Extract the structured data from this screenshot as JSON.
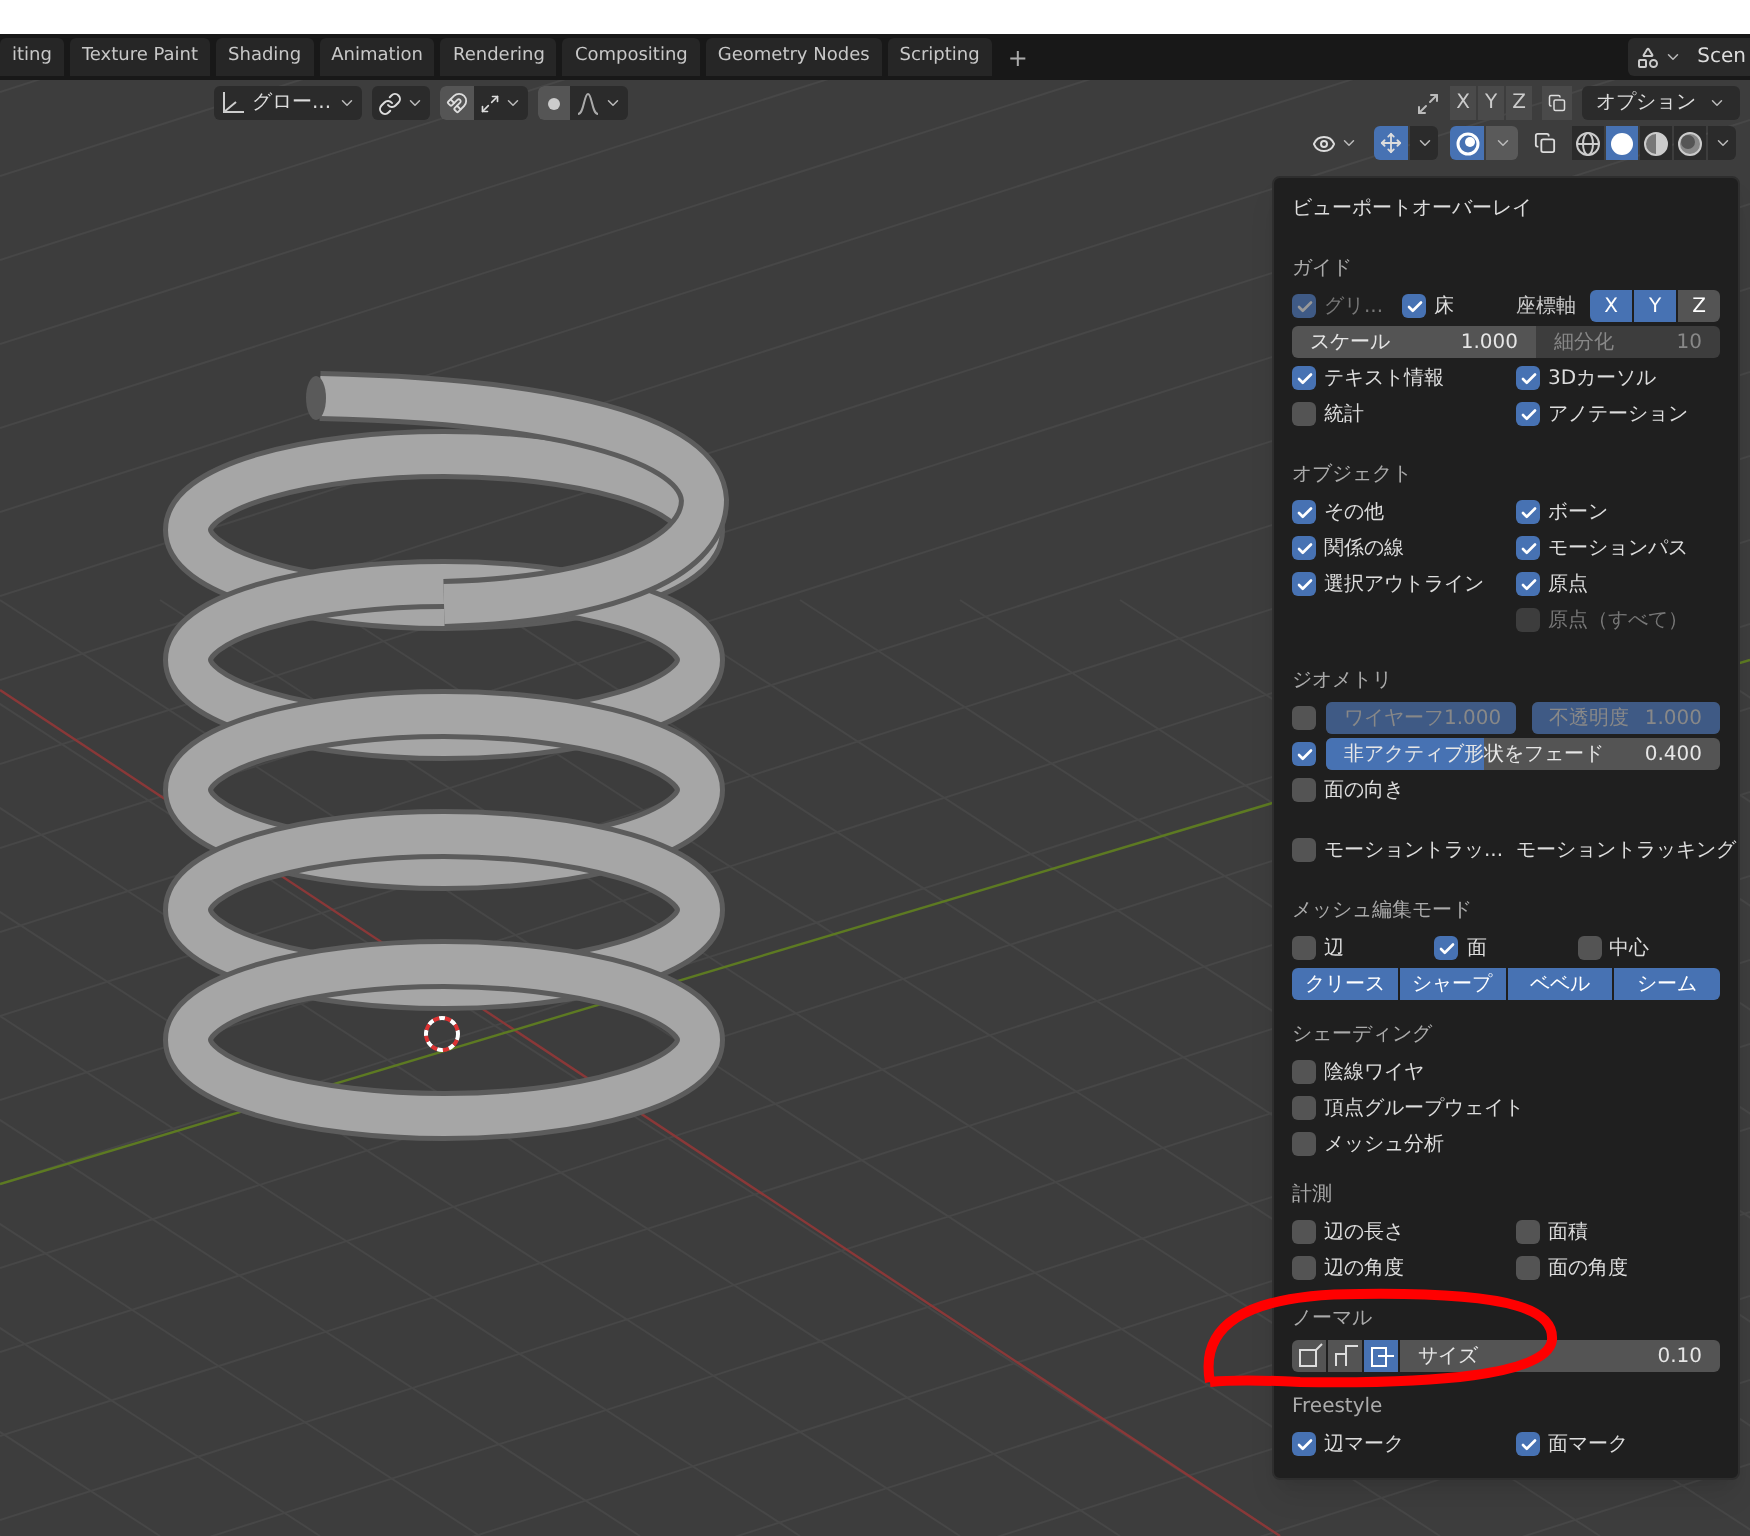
{
  "workspace_tabs": [
    {
      "label": "iting"
    },
    {
      "label": "Texture Paint"
    },
    {
      "label": "Shading"
    },
    {
      "label": "Animation"
    },
    {
      "label": "Rendering"
    },
    {
      "label": "Compositing"
    },
    {
      "label": "Geometry Nodes"
    },
    {
      "label": "Scripting"
    }
  ],
  "add_tab": "+",
  "scene": "Scen",
  "header": {
    "transform_orientation": "グロー...",
    "axis_buttons": [
      {
        "label": "X",
        "selected": false
      },
      {
        "label": "Y",
        "selected": false
      },
      {
        "label": "Z",
        "selected": false
      }
    ],
    "options": "オプション",
    "gizmo_on": true,
    "overlays_on": true,
    "shading_modes": [
      {
        "kind": "wireframe",
        "selected": false
      },
      {
        "kind": "solid",
        "selected": true
      },
      {
        "kind": "material",
        "selected": false
      },
      {
        "kind": "rendered",
        "selected": false
      }
    ]
  },
  "overlay_panel": {
    "title": "ビューポートオーバーレイ",
    "sections": [
      {
        "title": "ガイド",
        "rows": [
          {
            "kind": "guide",
            "grid": {
              "label": "グリ...",
              "checked": true,
              "disabled": true
            },
            "floor": {
              "label": "床",
              "checked": true,
              "disabled": false
            },
            "axes_label": "座標軸",
            "axes": [
              {
                "label": "X",
                "selected": true
              },
              {
                "label": "Y",
                "selected": true
              },
              {
                "label": "Z",
                "selected": false
              }
            ]
          },
          {
            "kind": "fields",
            "fields": [
              {
                "label": "スケール",
                "value": "1.000",
                "disabled": false
              },
              {
                "label": "細分化",
                "value": "10",
                "disabled": true
              }
            ]
          },
          {
            "kind": "columns",
            "left": [
              {
                "label": "テキスト情報",
                "checked": true,
                "disabled": false
              },
              {
                "label": "統計",
                "checked": false,
                "disabled": false
              }
            ],
            "right": [
              {
                "label": "3Dカーソル",
                "checked": true,
                "disabled": false
              },
              {
                "label": "アノテーション",
                "checked": true,
                "disabled": false
              }
            ]
          }
        ]
      },
      {
        "title": "オブジェクト",
        "rows": [
          {
            "kind": "columns",
            "left": [
              {
                "label": "その他",
                "checked": true,
                "disabled": false
              },
              {
                "label": "関係の線",
                "checked": true,
                "disabled": false
              },
              {
                "label": "選択アウトライン",
                "checked": true,
                "disabled": false
              }
            ],
            "right": [
              {
                "label": "ボーン",
                "checked": true,
                "disabled": false
              },
              {
                "label": "モーションパス",
                "checked": true,
                "disabled": false
              },
              {
                "label": "原点",
                "checked": true,
                "disabled": false
              },
              {
                "label": "原点（すべて）",
                "checked": false,
                "disabled": true
              }
            ]
          }
        ]
      },
      {
        "title": "ジオメトリ",
        "rows": [
          {
            "kind": "check_fields",
            "checked": false,
            "fields": [
              {
                "label": "ワイヤーフ",
                "value": "1.000",
                "disabled": true,
                "level": 1
              },
              {
                "label": "不透明度",
                "value": "1.000",
                "disabled": true,
                "level": 1
              }
            ]
          },
          {
            "kind": "check_fields",
            "checked": true,
            "fields": [
              {
                "label": "非アクティブ形状をフェード",
                "value": "0.400",
                "disabled": false,
                "level": 0.4
              }
            ]
          },
          {
            "kind": "columns",
            "left": [
              {
                "label": "面の向き",
                "checked": false,
                "disabled": false
              }
            ]
          }
        ]
      },
      {
        "rows": [
          {
            "kind": "check_label",
            "check": {
              "label": "モーショントラッ...",
              "checked": false,
              "disabled": false
            },
            "text": "モーショントラッキング"
          }
        ]
      },
      {
        "title": "メッシュ編集モード",
        "rows": [
          {
            "kind": "check_row",
            "checks": [
              {
                "label": "辺",
                "checked": false,
                "disabled": false
              },
              {
                "label": "面",
                "checked": true,
                "disabled": false
              },
              {
                "label": "中心",
                "checked": false,
                "disabled": false
              }
            ]
          },
          {
            "kind": "buttons",
            "buttons": [
              {
                "label": "クリース",
                "selected": true
              },
              {
                "label": "シャープ",
                "selected": true
              },
              {
                "label": "ベベル",
                "selected": true
              },
              {
                "label": "シーム",
                "selected": true
              }
            ]
          }
        ]
      },
      {
        "title": "シェーディング",
        "rows": [
          {
            "kind": "columns",
            "left": [
              {
                "label": "陰線ワイヤ",
                "checked": false,
                "disabled": false
              },
              {
                "label": "頂点グループウェイト",
                "checked": false,
                "disabled": false
              },
              {
                "label": "メッシュ分析",
                "checked": false,
                "disabled": false
              }
            ]
          }
        ]
      },
      {
        "title": "計測",
        "rows": [
          {
            "kind": "columns",
            "left": [
              {
                "label": "辺の長さ",
                "checked": false,
                "disabled": false
              },
              {
                "label": "辺の角度",
                "checked": false,
                "disabled": false
              }
            ],
            "right": [
              {
                "label": "面積",
                "checked": false,
                "disabled": false
              },
              {
                "label": "面の角度",
                "checked": false,
                "disabled": false
              }
            ]
          }
        ]
      },
      {
        "title": "ノーマル",
        "rows": [
          {
            "kind": "normals",
            "toggles": [
              {
                "kind": "vertex",
                "selected": false
              },
              {
                "kind": "split",
                "selected": false
              },
              {
                "kind": "face",
                "selected": true
              }
            ],
            "field": {
              "label": "サイズ",
              "value": "0.10"
            }
          }
        ]
      },
      {
        "title": "Freestyle",
        "rows": [
          {
            "kind": "columns",
            "left": [
              {
                "label": "辺マーク",
                "checked": true,
                "disabled": false
              }
            ],
            "right": [
              {
                "label": "面マーク",
                "checked": true,
                "disabled": false
              }
            ]
          }
        ]
      }
    ]
  }
}
